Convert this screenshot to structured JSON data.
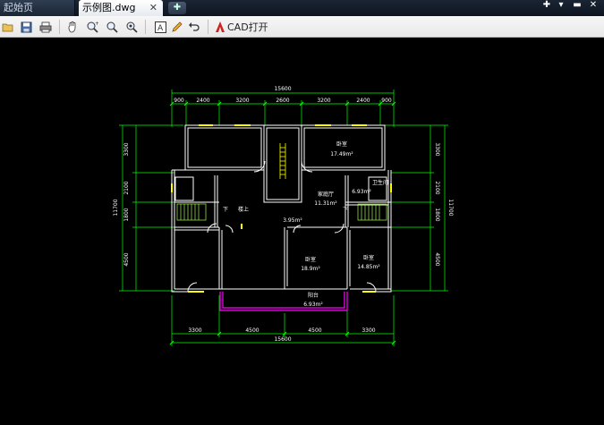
{
  "tabs": [
    {
      "label": "起始页",
      "active": false
    },
    {
      "label": "示例图.dwg",
      "active": true
    }
  ],
  "toolbar": {
    "icons": [
      "folder-open-icon",
      "save-icon",
      "print-icon",
      "pan-icon",
      "zoom-window-icon",
      "zoom-icon",
      "zoom-realtime-icon",
      "text-icon",
      "pencil-icon",
      "undo-icon"
    ],
    "cad_open_label": "CAD打开"
  },
  "drawing": {
    "colors": {
      "walls": "#ffffff",
      "dimension": "#00ff00",
      "windows": "#ffff00",
      "balcony": "#ff00ff"
    },
    "dims_top": [
      "900",
      "2400",
      "3200",
      "2600",
      "3200",
      "2400",
      "900"
    ],
    "dims_top_total": "15600",
    "dims_bottom": [
      "3300",
      "4500",
      "4500",
      "3300"
    ],
    "dims_bottom_total": "15600",
    "dims_left": [
      "3300",
      "2100",
      "1800",
      "4500"
    ],
    "dims_left_total": "11700",
    "dims_right": [
      "3300",
      "2100",
      "1800",
      "4500"
    ],
    "dims_right_total": "11700",
    "rooms": {
      "bedroom_top_label": "卧室",
      "bedroom_top_area": "17.49m²",
      "living_label": "家庭厅",
      "living_area": "11.31m²",
      "bath_area": "6.93m²",
      "bath_label": "卫生间",
      "stair_label": "楼上",
      "hall_area": "3.95m²",
      "bedroom_mid_label": "卧室",
      "bedroom_mid_area": "18.9m²",
      "bedroom_right_label": "卧室",
      "bedroom_right_area": "14.85m²",
      "balcony_label": "阳台",
      "balcony_area": "6.93m²",
      "door_mark_left": "下",
      "door_mark_right": "下"
    }
  }
}
